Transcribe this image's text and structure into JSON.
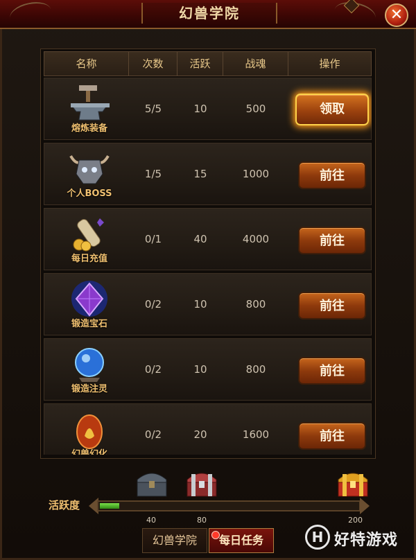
{
  "window": {
    "title": "幻兽学院"
  },
  "table": {
    "headers": [
      "名称",
      "次数",
      "活跃",
      "战魂",
      "操作"
    ],
    "rows": [
      {
        "name": "熔炼装备",
        "icon": "anvil-icon",
        "count": "5/5",
        "activity": "10",
        "soul": "500",
        "action": "领取"
      },
      {
        "name": "个人BOSS",
        "icon": "demon-skull-icon",
        "count": "1/5",
        "activity": "15",
        "soul": "1000",
        "action": "前往"
      },
      {
        "name": "每日充值",
        "icon": "scroll-coins-icon",
        "count": "0/1",
        "activity": "40",
        "soul": "4000",
        "action": "前往"
      },
      {
        "name": "锻造宝石",
        "icon": "purple-gem-icon",
        "count": "0/2",
        "activity": "10",
        "soul": "800",
        "action": "前往"
      },
      {
        "name": "锻造注灵",
        "icon": "blue-orb-icon",
        "count": "0/2",
        "activity": "10",
        "soul": "800",
        "action": "前往"
      },
      {
        "name": "幻兽幻化",
        "icon": "flame-egg-icon",
        "count": "0/2",
        "activity": "20",
        "soul": "1600",
        "action": "前往"
      }
    ]
  },
  "activity": {
    "label": "活跃度",
    "current": 15,
    "max": 200,
    "milestones": [
      {
        "value": 40,
        "label": "40",
        "chest": "iron-chest-icon"
      },
      {
        "value": 80,
        "label": "80",
        "chest": "silver-chest-icon"
      },
      {
        "value": 200,
        "label": "200",
        "chest": "gold-chest-icon"
      }
    ]
  },
  "tabs": [
    {
      "label": "幻兽学院",
      "active": false
    },
    {
      "label": "每日任务",
      "active": true,
      "badge": true
    }
  ],
  "watermark": {
    "text": "好特游戏",
    "logo": "H"
  },
  "colors": {
    "accent": "#f0c070",
    "button": "#9c420e",
    "highlight": "#ffd34a",
    "progress": "#4cb82a"
  }
}
